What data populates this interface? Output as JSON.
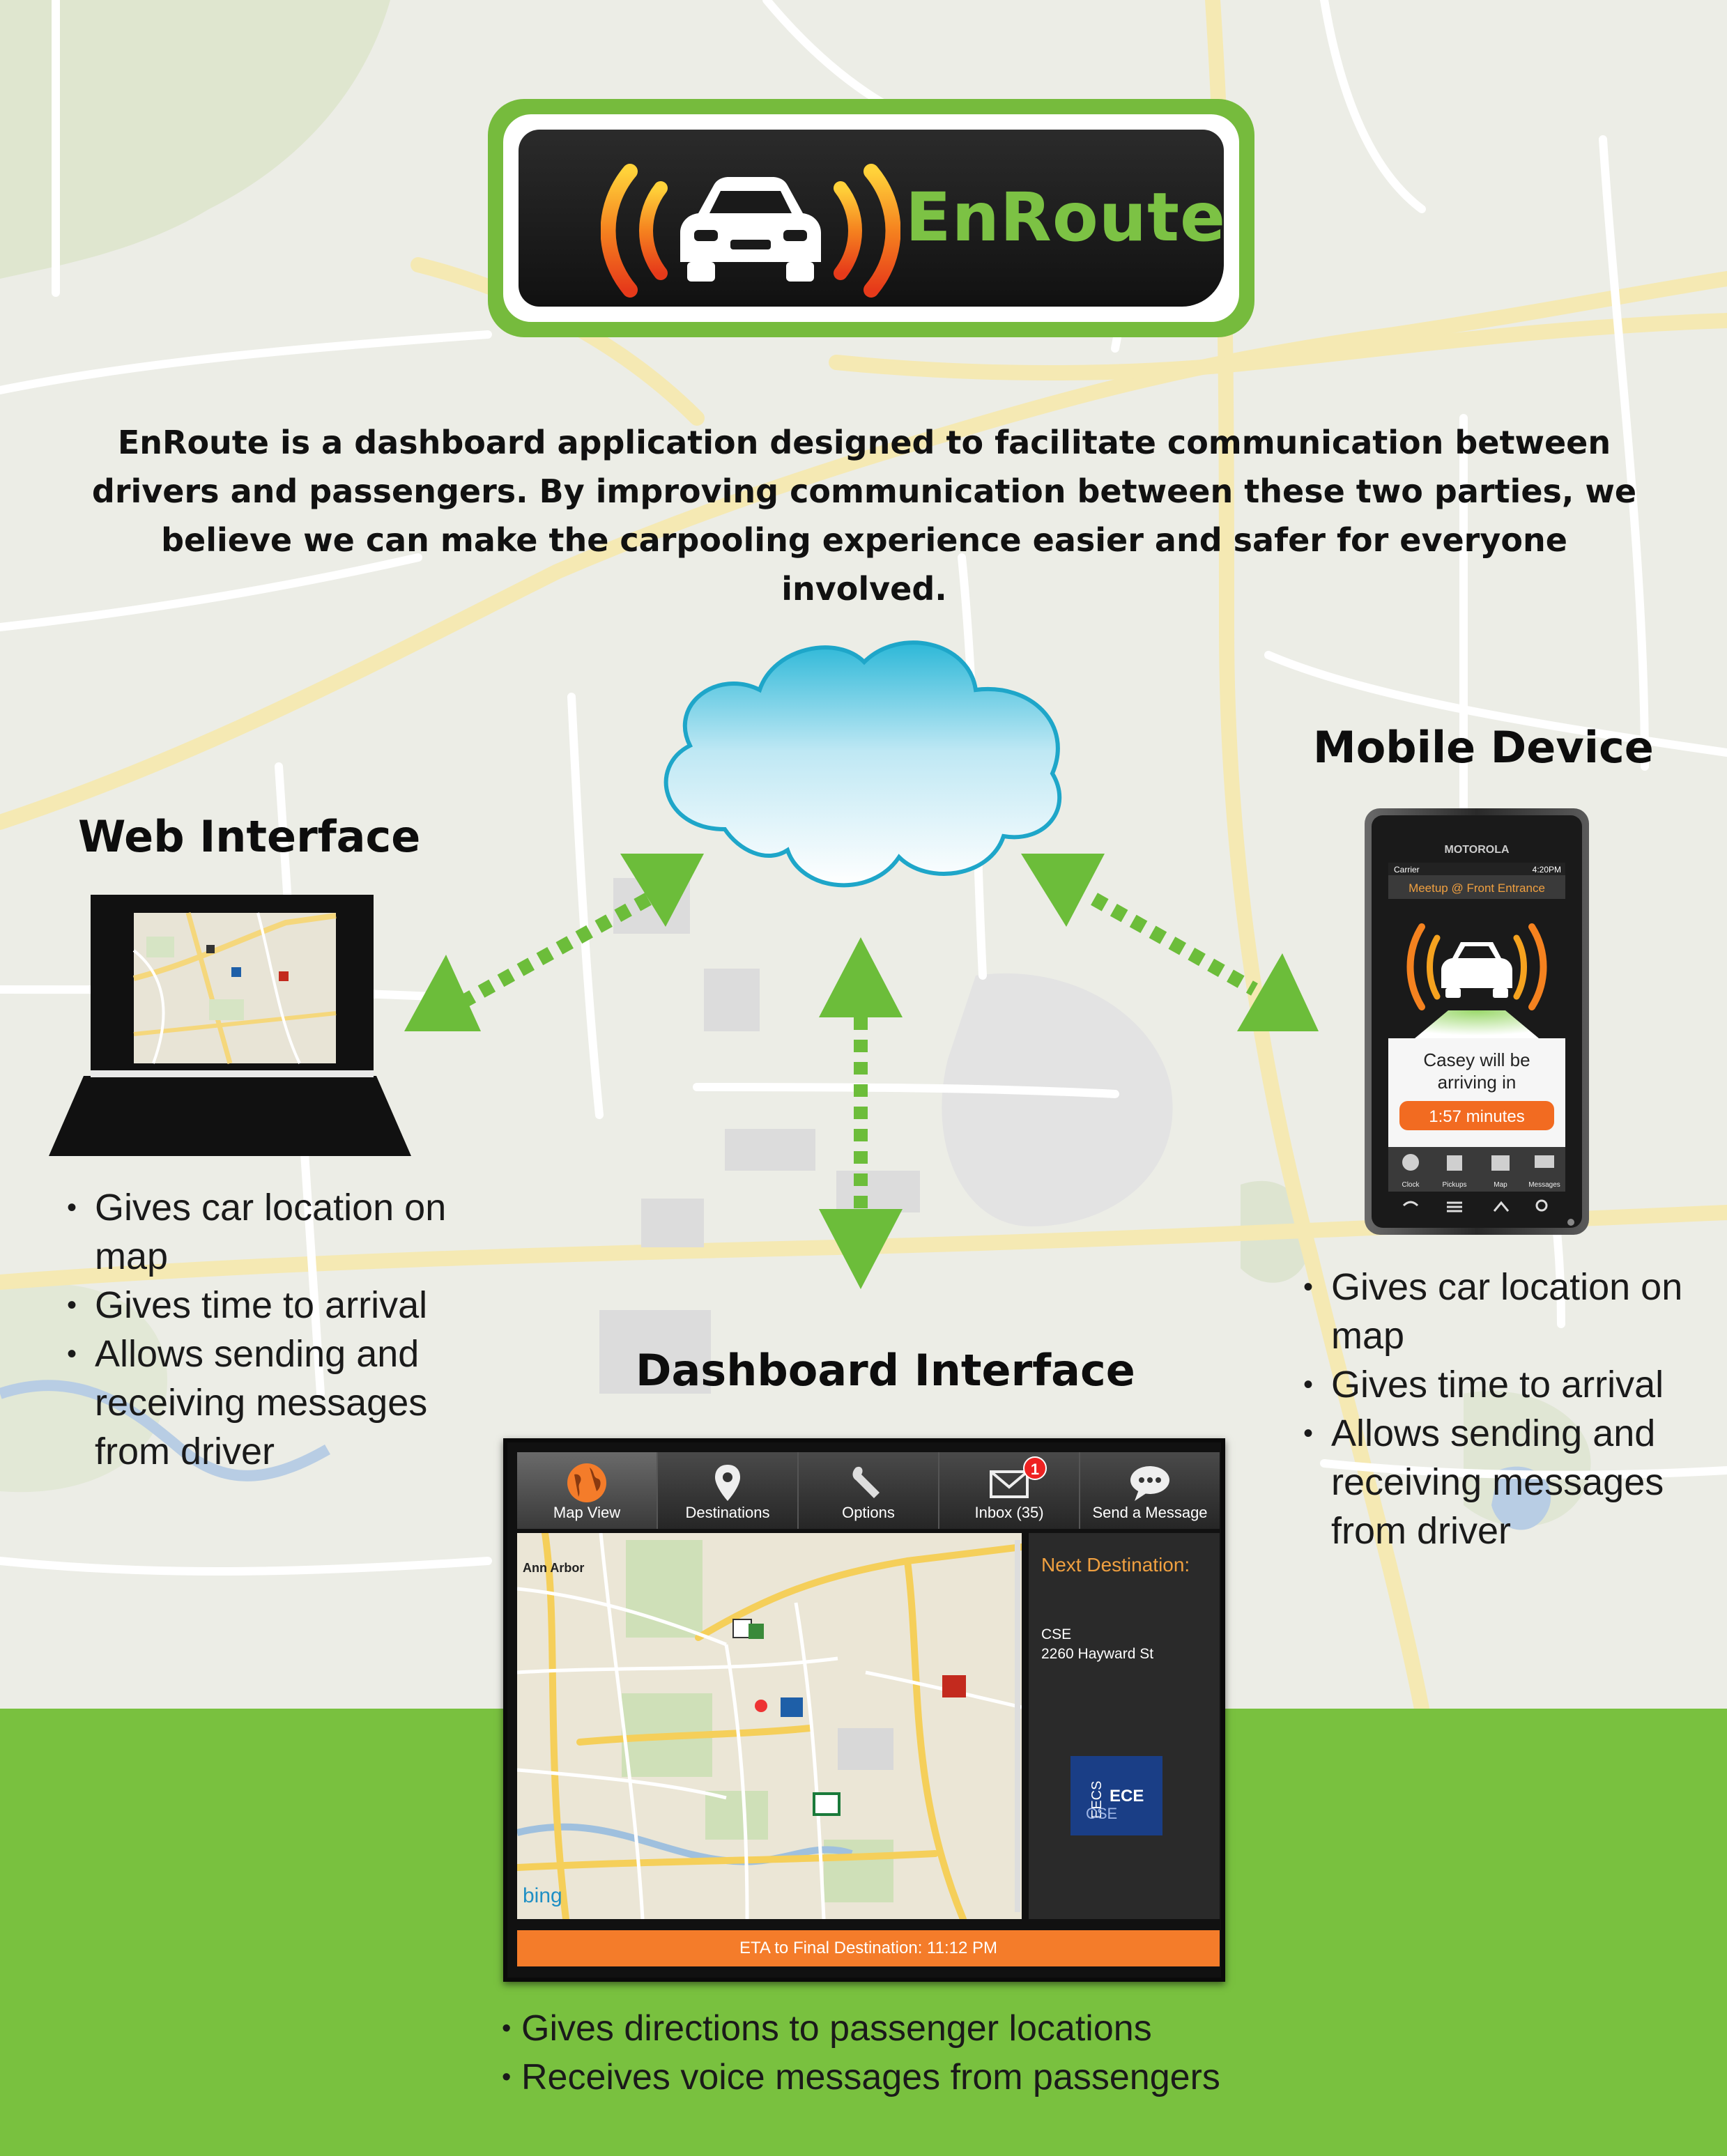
{
  "logo": {
    "name": "EnRoute"
  },
  "intro": {
    "line1": "EnRoute is a dashboard application designed to facilitate communication between",
    "line2": "drivers and passengers. By improving communication between these two parties, we",
    "line3": "believe we can make the carpooling experience easier and safer for everyone involved."
  },
  "web": {
    "title": "Web Interface",
    "bullets": [
      "Gives car location on map",
      "Gives time to arrival",
      "Allows sending and receiving messages from driver"
    ]
  },
  "mobile": {
    "title": "Mobile Device",
    "brand": "MOTOROLA",
    "carrier": "Carrier",
    "time": "4:20PM",
    "meetup": "Meetup @ Front Entrance",
    "status_line1": "Casey will be",
    "status_line2": "arriving in",
    "eta": "1:57 minutes",
    "tabs": [
      "Clock",
      "Pickups",
      "Map",
      "Messages"
    ],
    "bullets": [
      "Gives car location on map",
      "Gives time to arrival",
      "Allows sending and receiving messages from driver"
    ]
  },
  "dashboard": {
    "title": "Dashboard Interface",
    "nav": [
      {
        "label": "Map View",
        "icon": "globe-icon",
        "active": true
      },
      {
        "label": "Destinations",
        "icon": "pin-icon"
      },
      {
        "label": "Options",
        "icon": "wrench-icon"
      },
      {
        "label": "Inbox (35)",
        "icon": "mail-icon",
        "badge": "1"
      },
      {
        "label": "Send a Message",
        "icon": "speech-bubble-icon"
      }
    ],
    "next_label": "Next Destination:",
    "destination_name": "CSE",
    "destination_address": "2260 Hayward St",
    "eece_big": "ECE",
    "eece_small": "CSE",
    "eece_vertical": "EECS",
    "map_city": "Ann Arbor",
    "map_credit": "bing",
    "eta_bar": "ETA to Final Destination: 11:12 PM",
    "bullets": [
      "Gives directions to passenger locations",
      "Receives voice messages from passengers"
    ]
  },
  "colors": {
    "green": "#79c13f",
    "orange": "#f47c2a",
    "logo_green": "#7cc244"
  }
}
